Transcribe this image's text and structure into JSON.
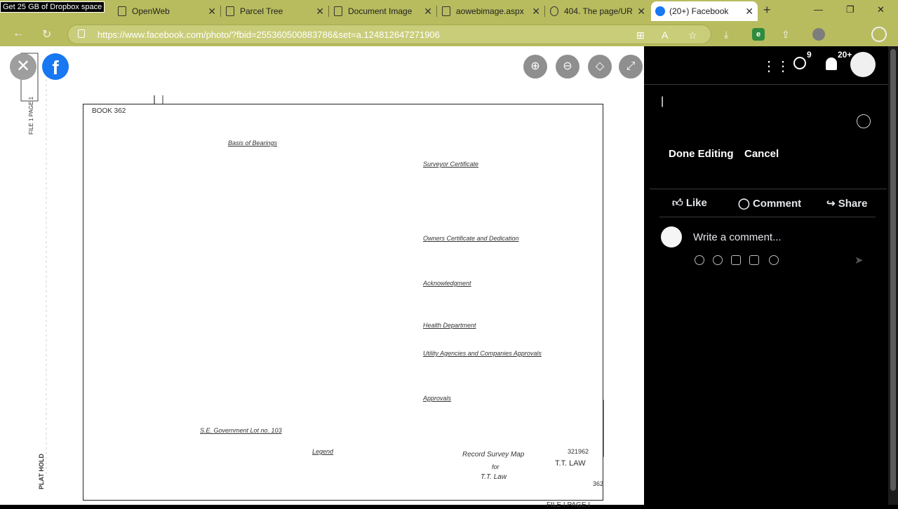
{
  "banner": "Get 25 GB of Dropbox space",
  "tabs": [
    {
      "label": "OpenWeb"
    },
    {
      "label": "Parcel Tree"
    },
    {
      "label": "Document Image"
    },
    {
      "label": "aowebimage.aspx"
    },
    {
      "label": "404. The page/UR"
    },
    {
      "label": "(20+) Facebook"
    }
  ],
  "address": {
    "url": "https://www.facebook.com/photo/?fbid=255360500883786&set=a.124812647271906"
  },
  "header": {
    "messenger_count": "9",
    "notifications_count": "20+"
  },
  "caption_editor": {
    "cursor": "|",
    "done_label": "Done Editing",
    "cancel_label": "Cancel"
  },
  "actions": {
    "like": "Like",
    "comment": "Comment",
    "share": "Share"
  },
  "comment": {
    "placeholder": "Write a comment..."
  },
  "document": {
    "book": "BOOK 362",
    "basis": "Basis of Bearings",
    "surveyor": "Surveyor Certificate",
    "owners": "Owners Certificate and Dedication",
    "ack": "Acknowledgment",
    "health": "Health Department",
    "utility": "Utility Agencies and Companies Approvals",
    "approvals": "Approvals",
    "legend": "Legend",
    "gov_lot": "S.E. Government Lot no. 103",
    "map_title": "Record Survey Map",
    "map_for": "for",
    "map_owner": "T.T. Law",
    "doc_num": "321962",
    "owner_stamp": "T.T. LAW",
    "page": "FILE I PAGE I",
    "book_num": "362",
    "side_label": "PLAT HOLD",
    "file_label": "FILE 1 PAGE 1"
  }
}
